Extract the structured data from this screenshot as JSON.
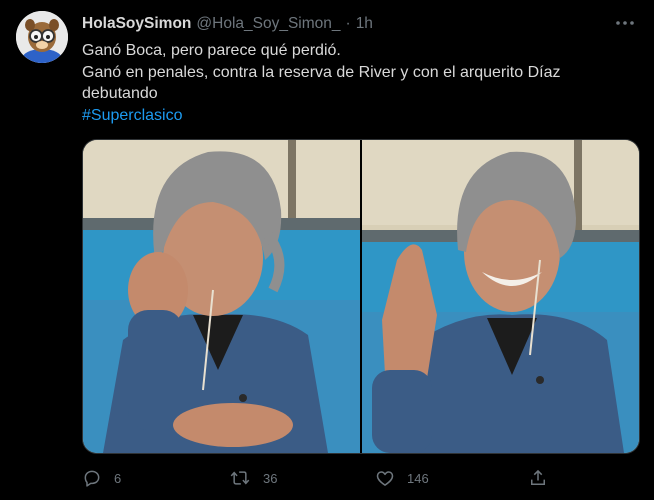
{
  "tweet": {
    "display_name": "HolaSoySimon",
    "handle": "@Hola_Soy_Simon_",
    "separator": "·",
    "time": "1h",
    "text_lines": [
      "Ganó Boca, pero parece qué perdió.",
      "Ganó en penales, contra la reserva de River y con el arquerito Díaz",
      "debutando"
    ],
    "hashtag": "#Superclasico",
    "actions": {
      "reply_count": "6",
      "retweet_count": "36",
      "like_count": "146"
    }
  },
  "colors": {
    "background": "#000000",
    "text": "#d9d9d9",
    "muted": "#6e767d",
    "link": "#1d9bf0"
  },
  "icons": [
    "more-icon",
    "reply-icon",
    "retweet-icon",
    "like-icon",
    "share-icon"
  ]
}
